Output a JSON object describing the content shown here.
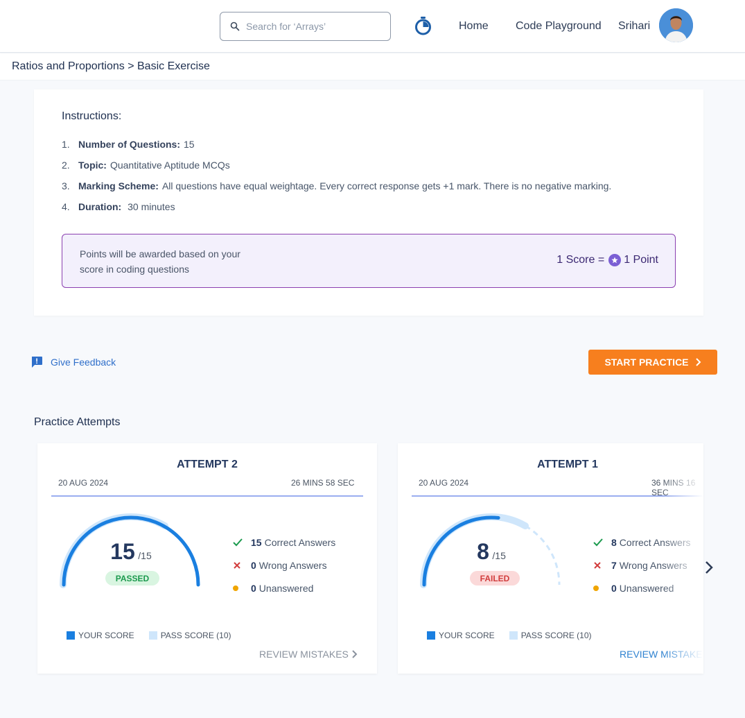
{
  "header": {
    "search_placeholder": "Search for ‘Arrays’",
    "nav": {
      "home": "Home",
      "playground": "Code Playground"
    },
    "user_name": "Srihari"
  },
  "breadcrumb": "Ratios and Proportions > Basic Exercise",
  "instructions": {
    "title": "Instructions:",
    "items": [
      {
        "num": "1.",
        "label": "Number of Questions:",
        "value": "15"
      },
      {
        "num": "2.",
        "label": "Topic:",
        "value": "Quantitative Aptitude MCQs"
      },
      {
        "num": "3.",
        "label": "Marking Scheme:",
        "value": "All questions have equal weightage. Every correct response gets +1 mark. There is no negative marking."
      },
      {
        "num": "4.",
        "label": "Duration:",
        "value": " 30 minutes"
      }
    ],
    "points_text": "Points will be awarded based on your score in coding questions",
    "points_left": "1 Score =",
    "points_right": "1 Point"
  },
  "actions": {
    "feedback": "Give Feedback",
    "start": "START PRACTICE"
  },
  "practice": {
    "title": "Practice Attempts",
    "attempts": [
      {
        "title": "ATTEMPT 2",
        "date": "20 AUG 2024",
        "duration": "26 MINS 58 SEC",
        "score": "15",
        "total": "/15",
        "score_fraction": 1.0,
        "pass_fraction": 0.6667,
        "status": "PASSED",
        "correct": "15",
        "correct_label": "Correct Answers",
        "wrong": "0",
        "wrong_label": "Wrong Answers",
        "unanswered": "0",
        "unanswered_label": "Unanswered",
        "review": "REVIEW MISTAKES"
      },
      {
        "title": "ATTEMPT 1",
        "date": "20 AUG 2024",
        "duration": "36 MINS 16 SEC",
        "score": "8",
        "total": "/15",
        "score_fraction": 0.5333,
        "pass_fraction": 0.6667,
        "status": "FAILED",
        "correct": "8",
        "correct_label": "Correct Answers",
        "wrong": "7",
        "wrong_label": "Wrong Answers",
        "unanswered": "0",
        "unanswered_label": "Unanswered",
        "review": "REVIEW MISTAKES"
      }
    ],
    "legend": {
      "your_score": "YOUR SCORE",
      "pass_score": "PASS SCORE (10)"
    }
  },
  "colors": {
    "accent_orange": "#f77f1e",
    "score_blue": "#1a7fe0",
    "pass_light_blue": "#cfe6fb",
    "purple_border": "#8b3fb0",
    "success": "#1c9a4e",
    "danger": "#d23d3d",
    "warning": "#f0a500"
  }
}
